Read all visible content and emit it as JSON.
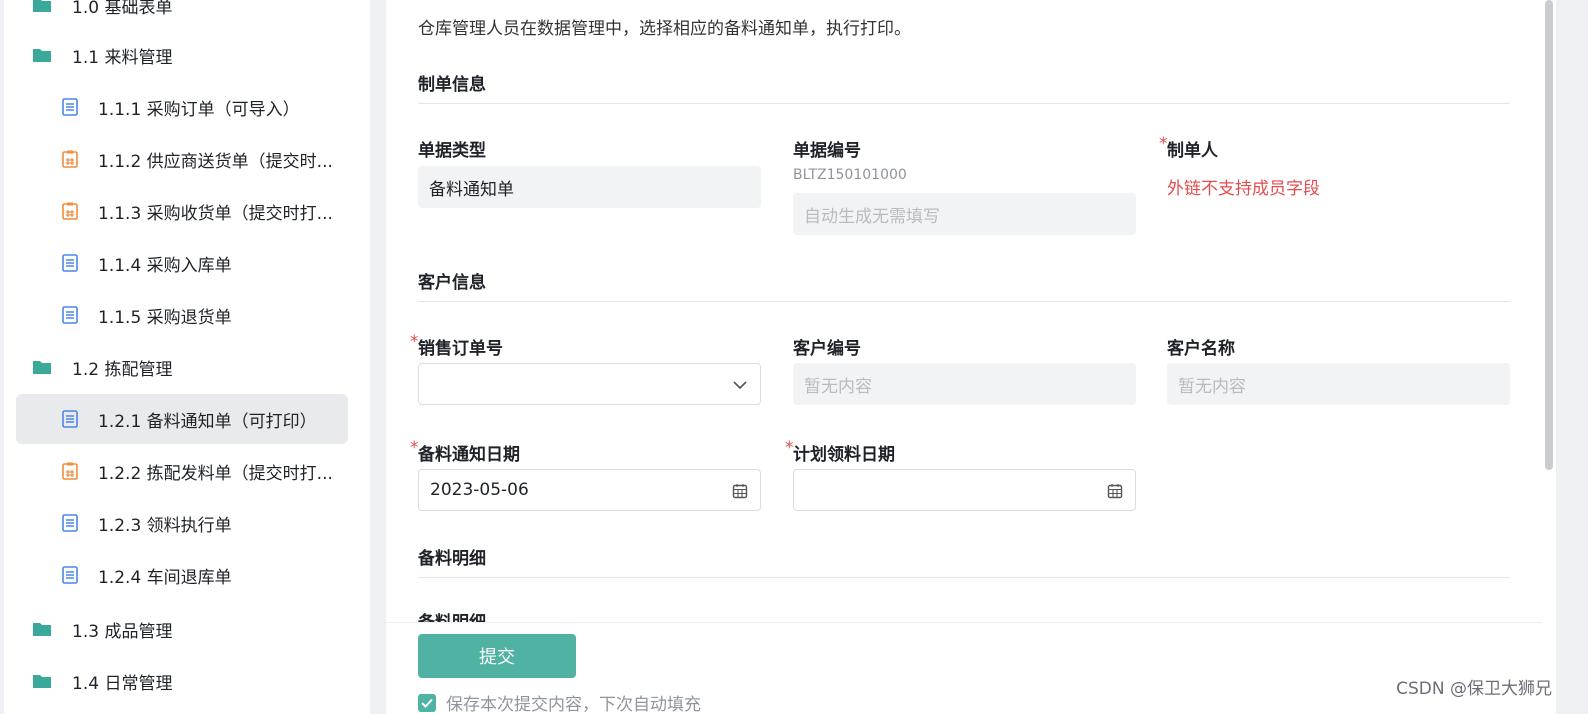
{
  "sidebar": {
    "items": [
      {
        "label": "1.0 基础表单",
        "type": "folder"
      },
      {
        "label": "1.1 来料管理",
        "type": "folder"
      },
      {
        "label": "1.1.1 采购订单（可导入）",
        "type": "doc"
      },
      {
        "label": "1.1.2 供应商送货单（提交时...",
        "type": "print"
      },
      {
        "label": "1.1.3 采购收货单（提交时打...",
        "type": "print"
      },
      {
        "label": "1.1.4 采购入库单",
        "type": "doc"
      },
      {
        "label": "1.1.5 采购退货单",
        "type": "doc"
      },
      {
        "label": "1.2 拣配管理",
        "type": "folder"
      },
      {
        "label": "1.2.1 备料通知单（可打印）",
        "type": "doc",
        "active": true
      },
      {
        "label": "1.2.2 拣配发料单（提交时打...",
        "type": "print"
      },
      {
        "label": "1.2.3 领料执行单",
        "type": "doc"
      },
      {
        "label": "1.2.4 车间退库单",
        "type": "doc"
      },
      {
        "label": "1.3 成品管理",
        "type": "folder"
      },
      {
        "label": "1.4 日常管理",
        "type": "folder"
      }
    ]
  },
  "form": {
    "description": "仓库管理人员在数据管理中，选择相应的备料通知单，执行打印。",
    "sections": {
      "order_info": "制单信息",
      "customer_info": "客户信息",
      "detail": "备料明细"
    },
    "doc_type": {
      "label": "单据类型",
      "value": "备料通知单"
    },
    "doc_no": {
      "label": "单据编号",
      "hint": "BLTZ150101000",
      "placeholder": "自动生成无需填写"
    },
    "creator": {
      "label": "制单人",
      "required_mark": "*",
      "warning": "外链不支持成员字段"
    },
    "sales_order_no": {
      "label": "销售订单号",
      "required_mark": "*",
      "value": ""
    },
    "customer_no": {
      "label": "客户编号",
      "placeholder": "暂无内容"
    },
    "customer_name": {
      "label": "客户名称",
      "placeholder": "暂无内容"
    },
    "notice_date": {
      "label": "备料通知日期",
      "required_mark": "*",
      "value": "2023-05-06"
    },
    "plan_date": {
      "label": "计划领料日期",
      "required_mark": "*",
      "value": ""
    },
    "detail_field": {
      "label": "备料明细",
      "required_mark": "*"
    },
    "submit_label": "提交",
    "save_label": "保存本次提交内容，下次自动填充"
  },
  "watermark": "CSDN @保卫大狮兄",
  "colors": {
    "accent": "#4fb2a3",
    "required": "#e34d4d",
    "folder": "#3aa99a",
    "doc": "#4a86e8",
    "print": "#f08c3a"
  }
}
